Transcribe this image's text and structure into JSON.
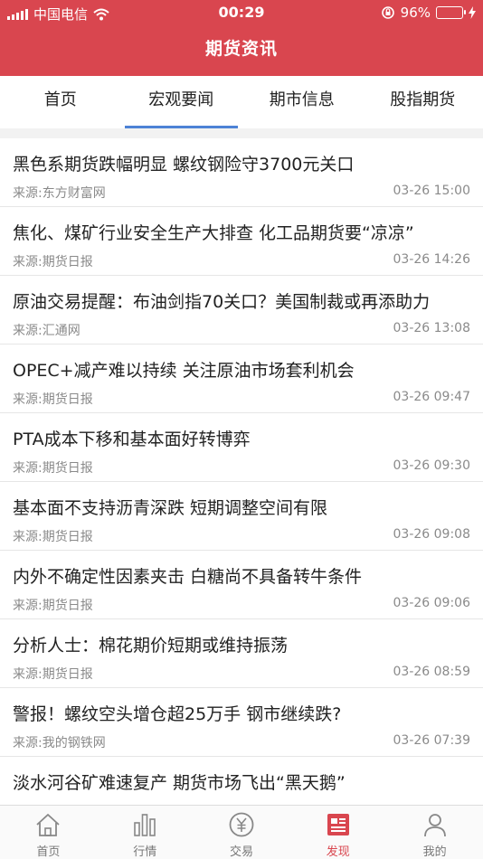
{
  "status_bar": {
    "carrier": "中国电信",
    "time": "00:29",
    "battery": "96%",
    "battery_level": 0.96
  },
  "header": {
    "title": "期货资讯"
  },
  "tabs": [
    {
      "label": "首页",
      "active": false
    },
    {
      "label": "宏观要闻",
      "active": true
    },
    {
      "label": "期市信息",
      "active": false
    },
    {
      "label": "股指期货",
      "active": false
    }
  ],
  "news": [
    {
      "title": "黑色系期货跌幅明显 螺纹钢险守3700元关口",
      "source": "来源:东方财富网",
      "time": "03-26 15:00"
    },
    {
      "title": "焦化、煤矿行业安全生产大排查 化工品期货要“凉凉”",
      "source": "来源:期货日报",
      "time": "03-26 14:26"
    },
    {
      "title": "原油交易提醒：布油剑指70关口？美国制裁或再添助力",
      "source": "来源:汇通网",
      "time": "03-26 13:08"
    },
    {
      "title": "OPEC+减产难以持续 关注原油市场套利机会",
      "source": "来源:期货日报",
      "time": "03-26 09:47"
    },
    {
      "title": "PTA成本下移和基本面好转博弈",
      "source": "来源:期货日报",
      "time": "03-26 09:30"
    },
    {
      "title": "基本面不支持沥青深跌 短期调整空间有限",
      "source": "来源:期货日报",
      "time": "03-26 09:08"
    },
    {
      "title": "内外不确定性因素夹击 白糖尚不具备转牛条件",
      "source": "来源:期货日报",
      "time": "03-26 09:06"
    },
    {
      "title": "分析人士：棉花期价短期或维持振荡",
      "source": "来源:期货日报",
      "time": "03-26 08:59"
    },
    {
      "title": "警报！螺纹空头增仓超25万手 钢市继续跌?",
      "source": "来源:我的钢铁网",
      "time": "03-26 07:39"
    },
    {
      "title": "淡水河谷矿难速复产 期货市场飞出“黑天鹅”",
      "source": "",
      "time": ""
    }
  ],
  "bottom_nav": [
    {
      "label": "首页",
      "icon": "home-icon",
      "active": false
    },
    {
      "label": "行情",
      "icon": "chart-icon",
      "active": false
    },
    {
      "label": "交易",
      "icon": "yen-icon",
      "active": false
    },
    {
      "label": "发现",
      "icon": "news-icon",
      "active": true
    },
    {
      "label": "我的",
      "icon": "user-icon",
      "active": false
    }
  ],
  "colors": {
    "brand": "#d9464f",
    "tab_indicator": "#4d82d6"
  }
}
